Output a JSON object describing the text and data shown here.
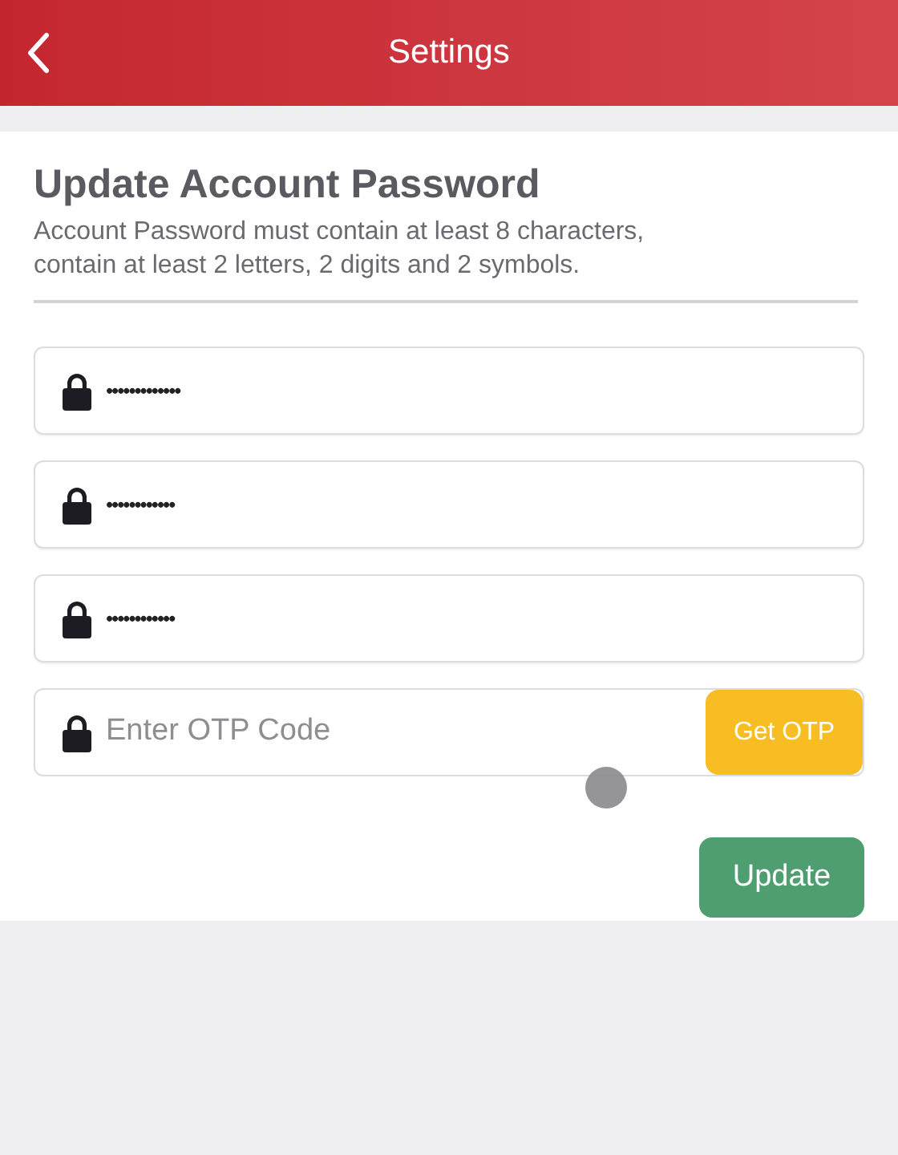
{
  "header": {
    "title": "Settings"
  },
  "section": {
    "title": "Update Account Password",
    "description": "Account Password must contain at least 8 characters, contain at least 2 letters, 2 digits and 2 symbols."
  },
  "fields": [
    {
      "kind": "password",
      "value": "•••••••••••••"
    },
    {
      "kind": "password",
      "value": "••••••••••••"
    },
    {
      "kind": "password",
      "value": "••••••••••••"
    },
    {
      "kind": "otp",
      "placeholder": "Enter OTP Code",
      "button": "Get OTP"
    }
  ],
  "submit": "Update"
}
